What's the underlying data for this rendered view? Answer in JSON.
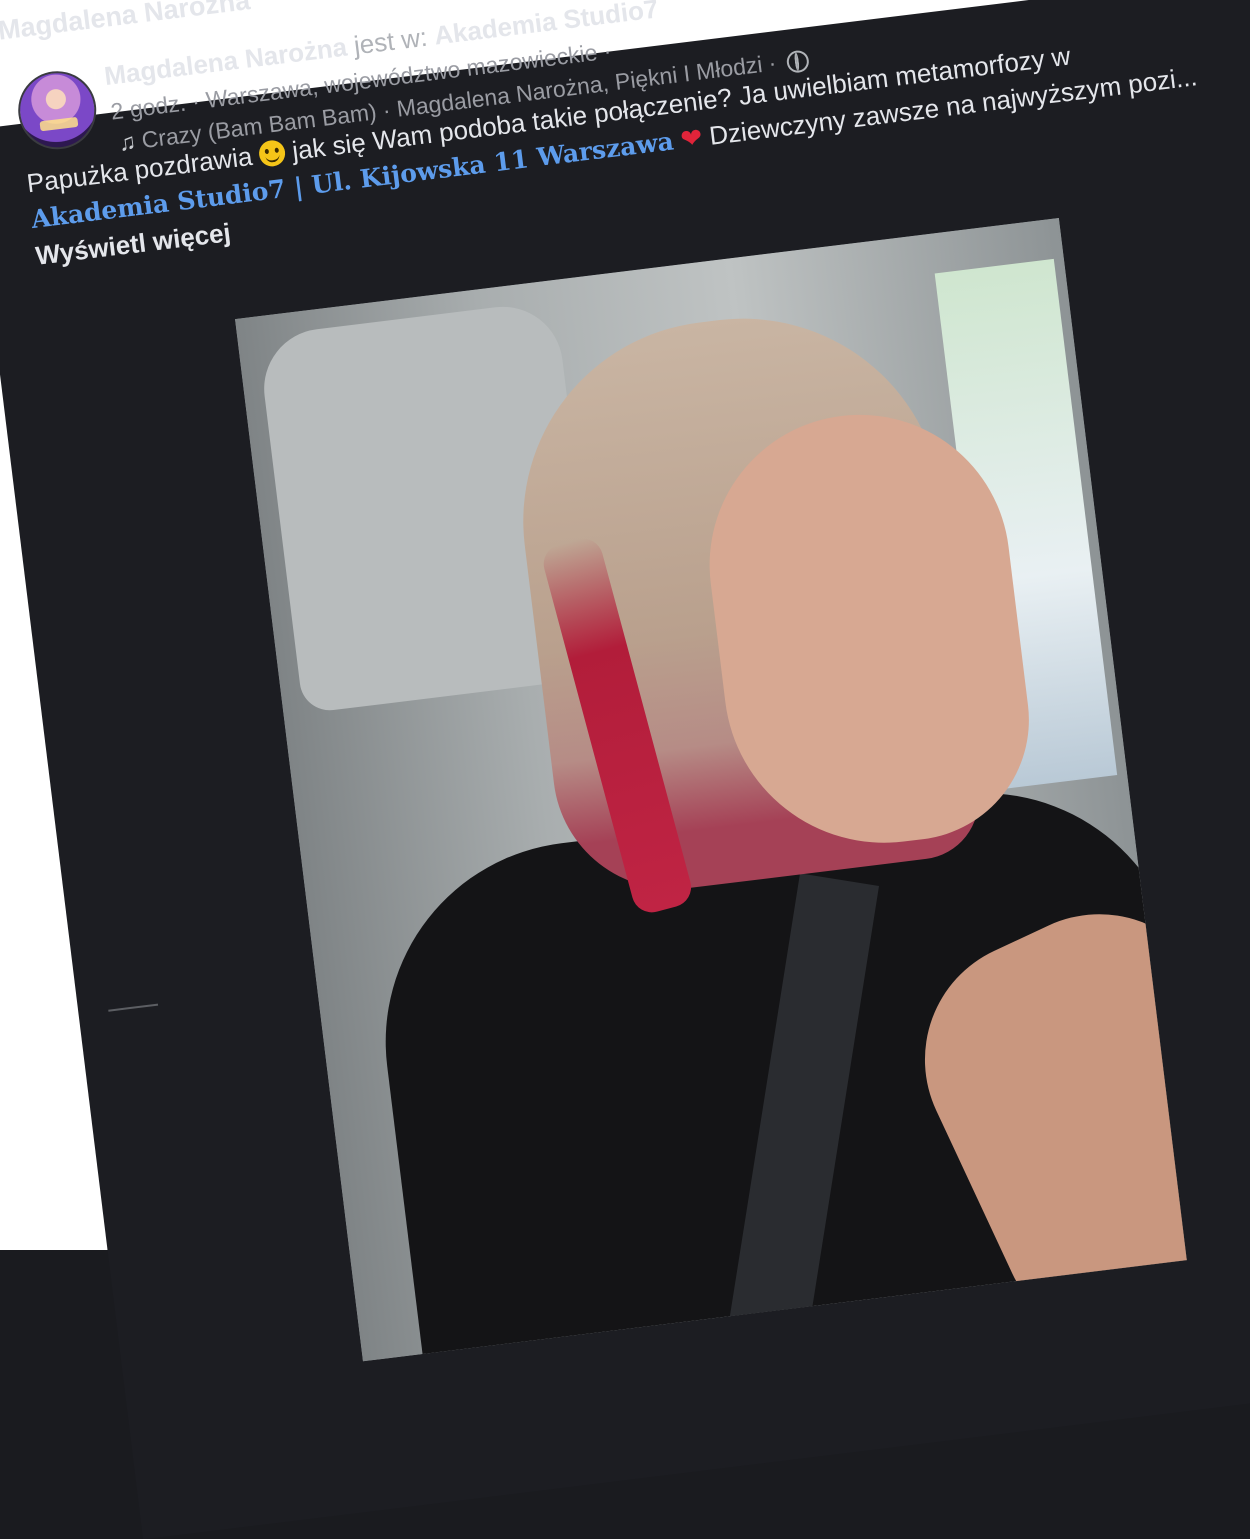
{
  "page_header": {
    "top_name": "Magdalena Narożna"
  },
  "post": {
    "author": "Magdalena Narożna",
    "is_at_label": "jest w:",
    "location_name": "Akademia Studio7",
    "time": "2 godz.",
    "meta_text": " · Warszawa, województwo mazowieckie ·",
    "music": "Crazy (Bam Bam Bam) · Magdalena Narożna, Piękni I Młodzi ·",
    "text_part1": "Papużka pozdrawia ",
    "text_part2": " jak się Wam podoba takie połączenie? Ja uwielbiam metamorfozy w ",
    "link_text": "Akademia Studio7 | Ul. Kijowska 11 Warszawa",
    "text_part3": " Dziewczyny zawsze na najwyższym pozi...",
    "see_more": "Wyświetl więcej"
  },
  "icons": {
    "privacy": "globe-icon",
    "music": "music-note-icon",
    "emoji1": "smiling-face-icon",
    "emoji2": "red-heart-icon"
  },
  "colors": {
    "background": "#1c1d22",
    "link": "#5d9cec",
    "text": "#e4e6eb",
    "secondary_text": "#b0b3b8"
  }
}
